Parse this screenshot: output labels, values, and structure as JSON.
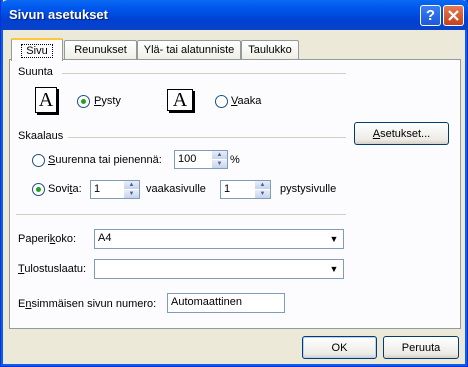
{
  "window": {
    "title": "Sivun asetukset"
  },
  "tabs": [
    "Sivu",
    "Reunukset",
    "Ylä- tai alatunniste",
    "Taulukko"
  ],
  "orientation": {
    "group_label": "Suunta",
    "portrait_icon_text": "A",
    "landscape_icon_text": "A",
    "portrait": {
      "pre": "",
      "mn": "P",
      "post": "ysty",
      "selected": true
    },
    "landscape": {
      "pre": "",
      "mn": "V",
      "post": "aaka",
      "selected": false
    }
  },
  "scaling": {
    "group_label": "Skaalaus",
    "options_button": {
      "pre": "",
      "mn": "A",
      "post": "setukset..."
    },
    "adjust": {
      "pre": "",
      "mn": "S",
      "post": "uurenna tai pienennä:",
      "selected": false,
      "value": "100",
      "unit": "%"
    },
    "fit": {
      "pre": "Sovi",
      "mn": "t",
      "post": "a:",
      "selected": true,
      "pages_wide": "1",
      "wide_label": "vaakasivulle",
      "pages_tall": "1",
      "tall_label": "pystysivulle"
    }
  },
  "paper_size": {
    "pre": "Paperi",
    "mn": "k",
    "post": "oko:",
    "value": "A4"
  },
  "print_quality": {
    "pre": "",
    "mn": "T",
    "post": "ulostuslaatu:",
    "value": ""
  },
  "first_page": {
    "pre": "E",
    "mn": "n",
    "post": "simmäisen sivun numero:",
    "value": "Automaattinen"
  },
  "footer": {
    "ok_label": "OK",
    "cancel_label": "Peruuta"
  }
}
